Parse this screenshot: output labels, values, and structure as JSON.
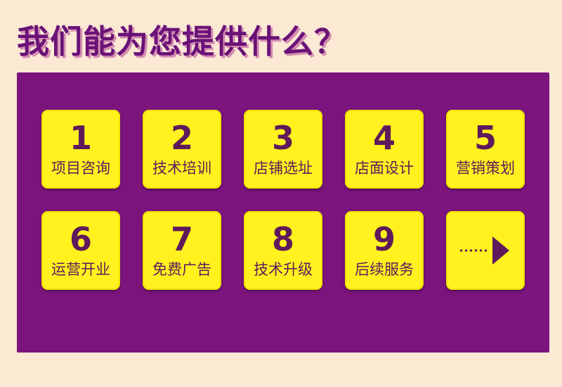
{
  "headline": "我们能为您提供什么？",
  "services": [
    {
      "number": "1",
      "label": "项目咨询"
    },
    {
      "number": "2",
      "label": "技术培训"
    },
    {
      "number": "3",
      "label": "店铺选址"
    },
    {
      "number": "4",
      "label": "店面设计"
    },
    {
      "number": "5",
      "label": "营销策划"
    },
    {
      "number": "6",
      "label": "运营开业"
    },
    {
      "number": "7",
      "label": "免费广告"
    },
    {
      "number": "8",
      "label": "技术升级"
    },
    {
      "number": "9",
      "label": "后续服务"
    }
  ],
  "next_icon": "arrow-right-icon",
  "colors": {
    "background": "#fbe9d4",
    "panel": "#7b147d",
    "tile": "#fff21e",
    "text_dark": "#5f1a5c",
    "headline": "#6a1278"
  }
}
